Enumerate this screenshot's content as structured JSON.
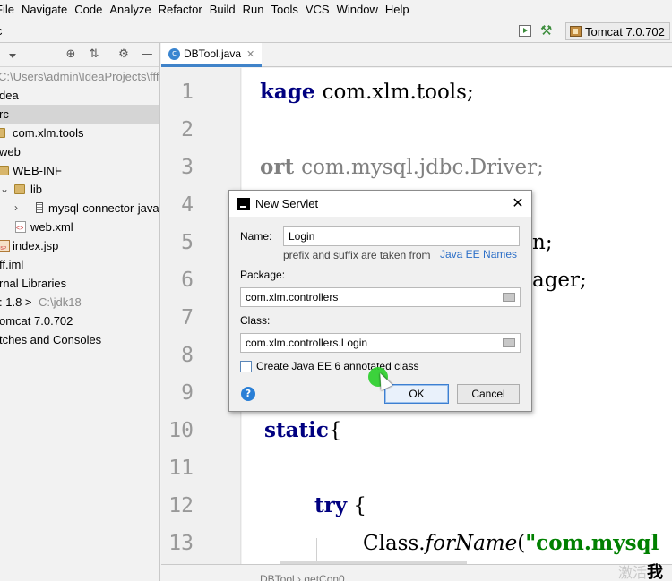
{
  "menubar": {
    "items": [
      "File",
      "Navigate",
      "Code",
      "Analyze",
      "Refactor",
      "Build",
      "Run",
      "Tools",
      "VCS",
      "Window",
      "Help"
    ]
  },
  "navbar": {
    "breadcrumb": "c",
    "run_config": "Tomcat 7.0.702"
  },
  "project": {
    "title": "t",
    "path": "C:\\Users\\admin\\IdeaProjects\\fff",
    "rows": [
      {
        "label": "dea"
      },
      {
        "label": "rc"
      },
      {
        "label": "com.xlm.tools"
      },
      {
        "label": "web"
      },
      {
        "label": "WEB-INF"
      },
      {
        "label": "lib"
      },
      {
        "label": "mysql-connector-java"
      },
      {
        "label": "web.xml"
      },
      {
        "label": "index.jsp"
      },
      {
        "label": "ff.iml"
      },
      {
        "label": "rnal Libraries"
      },
      {
        "label": ": 1.8 >",
        "extra": "C:\\jdk18"
      },
      {
        "label": "omcat 7.0.702"
      },
      {
        "label": "tches and Consoles"
      }
    ]
  },
  "editor": {
    "tab_label": "DBTool.java",
    "line_numbers": [
      "1",
      "2",
      "3",
      "4",
      "5",
      "6",
      "7",
      "8",
      "9",
      "10",
      "11",
      "12",
      "13"
    ],
    "lines": {
      "l1a": "kage ",
      "l1b": "com.xlm.tools;",
      "l3a": "ort ",
      "l3b": "com.mysql.jdbc.Driver;",
      "l5": "n;",
      "l6": "ager;",
      "l10a": "static",
      "l10b": "{",
      "l12a": "try",
      "l12b": " {",
      "l13a": "Class.",
      "l13b": "forName",
      "l13c": "(",
      "l13d": "\"com.mysql"
    },
    "status_breadcrumb": "DBTool  ›  getCon0",
    "activate_text": "激活",
    "activate_bold": "我"
  },
  "dialog": {
    "title": "New Servlet",
    "name_label": "Name:",
    "name_value": "Login",
    "hint_text": "prefix and suffix are taken from",
    "hint_link": "Java EE Names",
    "package_label": "Package:",
    "package_value": "com.xlm.controllers",
    "class_label": "Class:",
    "class_value": "com.xlm.controllers.Login",
    "checkbox_label": "Create Java EE 6 annotated class",
    "checkbox_checked": false,
    "ok_label": "OK",
    "cancel_label": "Cancel"
  }
}
